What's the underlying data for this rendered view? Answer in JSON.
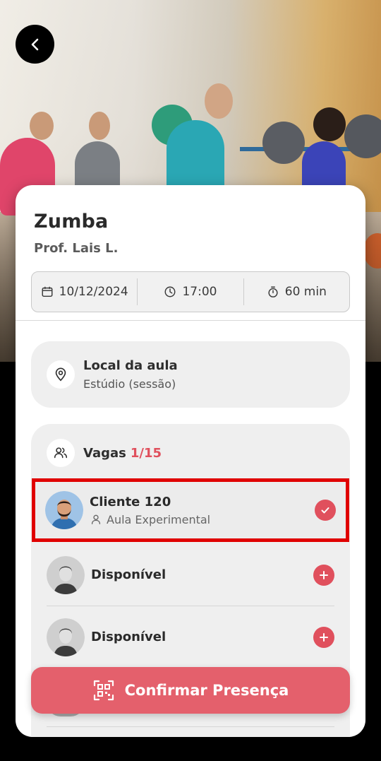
{
  "header": {
    "back_icon": "chevron-left-icon"
  },
  "class": {
    "title": "Zumba",
    "teacher": "Prof. Lais L.",
    "date": "10/12/2024",
    "time": "17:00",
    "duration": "60 min"
  },
  "location": {
    "title": "Local da aula",
    "value": "Estúdio (sessão)"
  },
  "slots": {
    "label": "Vagas",
    "count": "1/15",
    "items": [
      {
        "name": "Cliente 120",
        "subtitle": "Aula Experimental",
        "status": "confirmed"
      },
      {
        "name": "Disponível",
        "status": "available"
      },
      {
        "name": "Disponível",
        "status": "available"
      }
    ]
  },
  "confirm_button": {
    "label": "Confirmar Presença"
  },
  "colors": {
    "accent": "#e0505d",
    "button": "#e4606c",
    "highlight": "#e00000"
  }
}
